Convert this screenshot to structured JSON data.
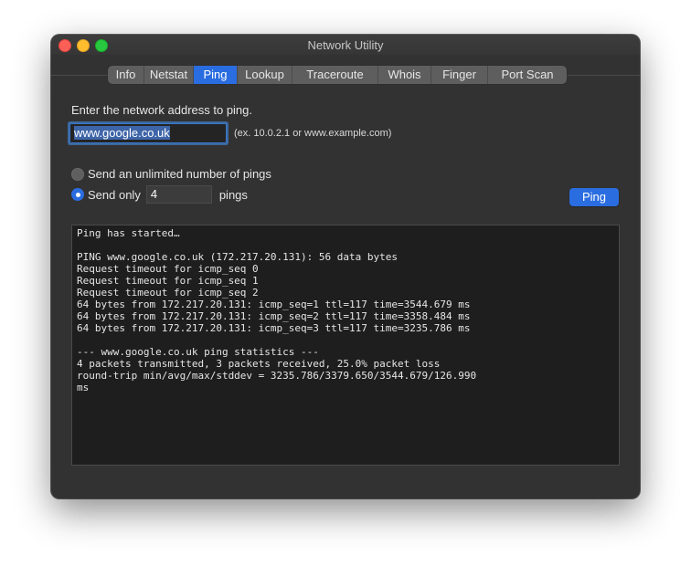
{
  "window": {
    "title": "Network Utility"
  },
  "tabs": [
    {
      "label": "Info",
      "width": 40
    },
    {
      "label": "Netstat",
      "width": 54
    },
    {
      "label": "Ping",
      "width": 48,
      "active": true
    },
    {
      "label": "Lookup",
      "width": 60
    },
    {
      "label": "Traceroute",
      "width": 94
    },
    {
      "label": "Whois",
      "width": 58
    },
    {
      "label": "Finger",
      "width": 62
    },
    {
      "label": "Port Scan",
      "width": 86
    }
  ],
  "ping": {
    "prompt": "Enter the network address to ping.",
    "address_value": "www.google.co.uk",
    "address_hint": "(ex. 10.0.2.1 or www.example.com)",
    "option_unlimited": "Send an unlimited number of pings",
    "option_only": "Send only",
    "count_value": "4",
    "count_unit": "pings",
    "button_label": "Ping",
    "selected_option": "only"
  },
  "output_lines": [
    "Ping has started…",
    "",
    "PING www.google.co.uk (172.217.20.131): 56 data bytes",
    "Request timeout for icmp_seq 0",
    "Request timeout for icmp_seq 1",
    "Request timeout for icmp_seq 2",
    "64 bytes from 172.217.20.131: icmp_seq=1 ttl=117 time=3544.679 ms",
    "64 bytes from 172.217.20.131: icmp_seq=2 ttl=117 time=3358.484 ms",
    "64 bytes from 172.217.20.131: icmp_seq=3 ttl=117 time=3235.786 ms",
    "",
    "--- www.google.co.uk ping statistics ---",
    "4 packets transmitted, 3 packets received, 25.0% packet loss",
    "round-trip min/avg/max/stddev = 3235.786/3379.650/3544.679/126.990",
    "ms"
  ],
  "colors": {
    "accent": "#2a6de0",
    "window_bg": "#323232",
    "output_bg": "#1e1e1e"
  }
}
